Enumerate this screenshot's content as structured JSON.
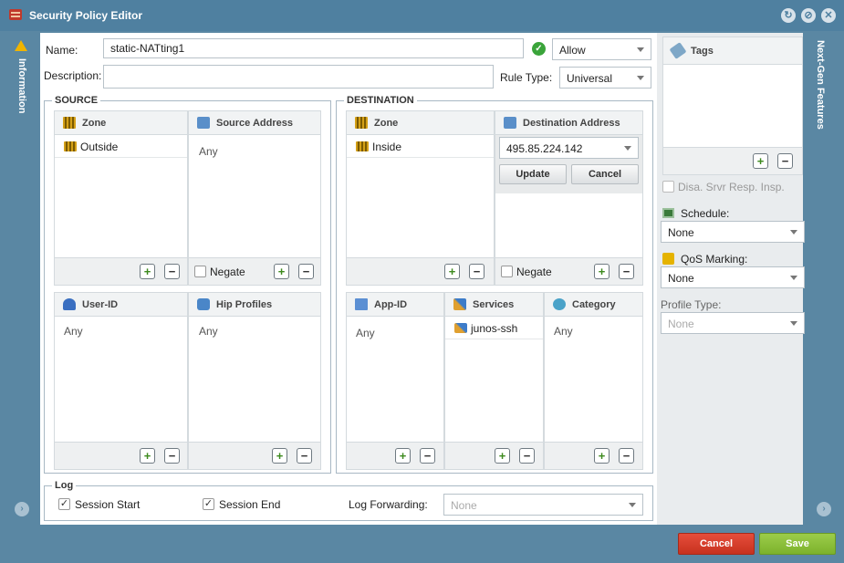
{
  "window": {
    "title": "Security Policy Editor",
    "left_tab": "Information",
    "right_tab": "Next-Gen Features"
  },
  "form": {
    "name_label": "Name:",
    "name_value": "static-NATting1",
    "action_value": "Allow",
    "description_label": "Description:",
    "description_value": "",
    "rule_type_label": "Rule Type:",
    "rule_type_value": "Universal"
  },
  "source": {
    "legend": "SOURCE",
    "zone_header": "Zone",
    "zone_items": [
      "Outside"
    ],
    "address_header": "Source Address",
    "address_any": "Any",
    "negate_label": "Negate",
    "userid_header": "User-ID",
    "userid_any": "Any",
    "hip_header": "Hip Profiles",
    "hip_any": "Any"
  },
  "destination": {
    "legend": "DESTINATION",
    "zone_header": "Zone",
    "zone_items": [
      "Inside"
    ],
    "address_header": "Destination Address",
    "address_value": "495.85.224.142",
    "update_label": "Update",
    "cancel_label": "Cancel",
    "negate_label": "Negate",
    "appid_header": "App-ID",
    "appid_any": "Any",
    "services_header": "Services",
    "services_items": [
      "junos-ssh"
    ],
    "category_header": "Category",
    "category_any": "Any"
  },
  "log": {
    "legend": "Log",
    "session_start_label": "Session Start",
    "session_start_checked": true,
    "session_end_label": "Session End",
    "session_end_checked": true,
    "forwarding_label": "Log Forwarding:",
    "forwarding_value": "None"
  },
  "side": {
    "tags_header": "Tags",
    "disa_label": "Disa. Srvr Resp. Insp.",
    "schedule_label": "Schedule:",
    "schedule_value": "None",
    "qos_label": "QoS Marking:",
    "qos_value": "None",
    "profile_type_label": "Profile Type:",
    "profile_type_value": "None"
  },
  "footer": {
    "cancel_label": "Cancel",
    "save_label": "Save"
  },
  "icons": {
    "plus": "+",
    "minus": "−",
    "check": "✓"
  }
}
